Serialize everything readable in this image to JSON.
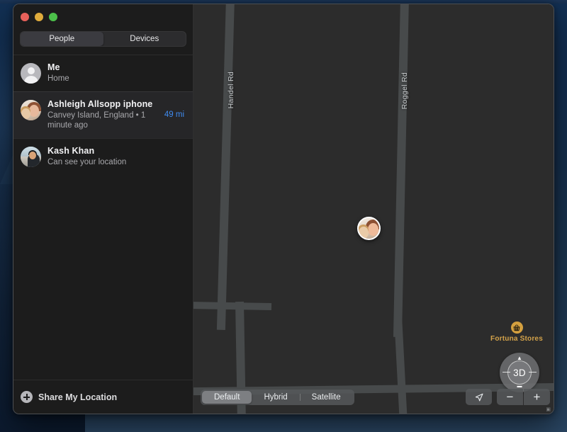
{
  "window": {
    "traffic_lights": [
      {
        "name": "close",
        "color": "#e8615a"
      },
      {
        "name": "minimize",
        "color": "#e0ac3c"
      },
      {
        "name": "maximize",
        "color": "#4cc04a"
      }
    ]
  },
  "sidebar": {
    "tabs": [
      {
        "label": "People",
        "selected": true
      },
      {
        "label": "Devices",
        "selected": false
      }
    ],
    "people": [
      {
        "name": "Me",
        "subtitle": "Home",
        "distance": "",
        "avatar": "generic-person-icon",
        "selected": false
      },
      {
        "name": "Ashleigh Allsopp iphone",
        "subtitle": "Canvey Island, England • 1 minute ago",
        "distance": "49 mi",
        "avatar": "photo-avatar-woman",
        "selected": true
      },
      {
        "name": "Kash Khan",
        "subtitle": "Can see your location",
        "distance": "",
        "avatar": "photo-avatar-man",
        "selected": false
      }
    ],
    "share": {
      "label": "Share My Location",
      "icon": "plus-circle-icon"
    }
  },
  "map": {
    "road_labels": [
      "Handel Rd",
      "Roggel Rd"
    ],
    "poi": {
      "label": "Fortuna Stores",
      "icon": "shopping-basket-icon",
      "color": "#d3a24a"
    },
    "person_pin": {
      "name": "Ashleigh Allsopp iphone",
      "avatar": "photo-avatar-woman"
    },
    "compass": {
      "label": "3D",
      "up": "▲",
      "down": "▬",
      "left": "—",
      "right": "—"
    },
    "modes": [
      {
        "label": "Default",
        "selected": true
      },
      {
        "label": "Hybrid",
        "selected": false
      },
      {
        "label": "Satellite",
        "selected": false
      }
    ],
    "controls": {
      "locate": "locate-arrow-icon",
      "zoom_out": "−",
      "zoom_in": "+"
    },
    "attribution": "▣"
  },
  "colors": {
    "accent_blue": "#3f8bf0",
    "poi_gold": "#d3a24a",
    "map_bg": "#2c2c2c",
    "road": "#474a4b",
    "sidebar_bg": "#1c1c1c"
  }
}
